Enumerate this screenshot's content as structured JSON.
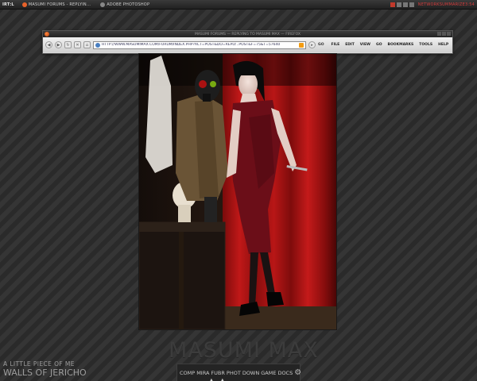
{
  "taskbar": {
    "start_label": "IRT:L",
    "tasks": [
      {
        "label": "MASUMI FORUMS - REPLYIN...",
        "icon": "firefox-icon",
        "color": "#e8622a"
      },
      {
        "label": "ADOBE PHOTOSHOP",
        "icon": "photoshop-icon",
        "color": "#888888"
      }
    ],
    "tray_text": "NETWORKSUMMARIZE3:54"
  },
  "browser": {
    "title": "MASUMI FORUMS — REPLYING TO MASUMI MAX — FIREFOX",
    "url": "HTTP://WWW.MASUMIMAX.COM/FORUM/INDEX.PHP?ACT=POST&DO=REPLY...POST&F=75&T=57640",
    "menu": [
      "FILE",
      "EDIT",
      "VIEW",
      "GO",
      "BOOKMARKS",
      "TOOLS",
      "HELP"
    ],
    "go_label": "GO"
  },
  "watermark": "MASUMI MAX",
  "now_playing": {
    "title": "A LITTLE PIECE OF ME",
    "artist": "WALLS OF JERICHO"
  },
  "dock": {
    "items": [
      "COMP",
      "MIRA",
      "FUBR",
      "PHOT",
      "DOWN",
      "GAME",
      "DOCS"
    ]
  },
  "colors": {
    "curtain": "#a31414",
    "dress": "#6e0f1a",
    "accent": "#c0392b"
  }
}
